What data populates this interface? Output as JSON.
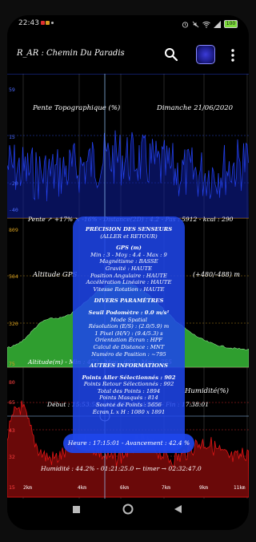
{
  "status": {
    "time": "22:43",
    "battery": "100"
  },
  "app": {
    "title": "R_AR : Chemin Du Paradis"
  },
  "panels": {
    "slope": {
      "title": "Pente Topographique (%)",
      "date": "Dimanche  21/06/2020",
      "y_top": "59",
      "y_mid": "15",
      "y_low": "-20",
      "y_bottom": "-40",
      "summary": "Pente  ↗ +17%  ↘ -16%  -  Distance(2D) : 4.2  -  Pas : 5912  -  kcal : 290"
    },
    "altitude": {
      "title_left": "Altitude GPS",
      "title_right": "(+480/-488) m",
      "y_top": "809",
      "y_mid": "564",
      "y_low": "320",
      "y_bottom": "75",
      "summary": "Altitude(m)  -  Min : 472  -  Moy : 622  -  Max : 755"
    },
    "humidity": {
      "title": "Humidité(%)",
      "y_top": "80",
      "y_m1": "65",
      "y_m2": "43",
      "y_m3": "32",
      "y_bottom": "15",
      "times": "Début : 15:53:58 - ALLER : 17:15:23 - Fin : 17:38:01",
      "summary": "Humidité : 44.2%  -  01:21:25.0 ← timer →  02:32:47.0"
    }
  },
  "overlay": {
    "lines": [
      {
        "text": "PRÉCISION DES SENSEURS",
        "h": true
      },
      {
        "text": "(ALLER et RETOUR)",
        "h": false
      },
      {
        "text": "GPS (m)",
        "h": true
      },
      {
        "text": "Min : 3 - Moy : 4.4 - Max : 9",
        "h": false
      },
      {
        "text": "Magnétisme : BASSE",
        "h": false
      },
      {
        "text": "Gravité : HAUTE",
        "h": false
      },
      {
        "text": "Position Angulaire : HAUTE",
        "h": false
      },
      {
        "text": "Accélération Linéaire : HAUTE",
        "h": false
      },
      {
        "text": "Vitesse Rotation : HAUTE",
        "h": false
      },
      {
        "text": "DIVERS PARAMÈTRES",
        "h": true
      },
      {
        "text": "Seuil Podomètre : 0.0 m/s²",
        "h": true
      },
      {
        "text": "Mode Spatial",
        "h": false
      },
      {
        "text": "Résolution (E/S) : (2.0/5.9) m",
        "h": false
      },
      {
        "text": "1 Pixel (H/V) : (9.4/5.3) s",
        "h": false
      },
      {
        "text": "Orientation Écran : HPF",
        "h": false
      },
      {
        "text": "Calcul de Distance : MNT",
        "h": false
      },
      {
        "text": "Numéro de Position : ~795",
        "h": false
      },
      {
        "text": "AUTRES INFORMATIONS",
        "h": true
      },
      {
        "text": "Points Aller Sélectionnés : 902",
        "h": true
      },
      {
        "text": "Points Retour Sélectionnés : 992",
        "h": false
      },
      {
        "text": "Total des Points : 1894",
        "h": false
      },
      {
        "text": "Points Masqués : 814",
        "h": false
      },
      {
        "text": "Source de Points : 5656",
        "h": false
      },
      {
        "text": "Écran L x H : 1080 x 1891",
        "h": false
      }
    ]
  },
  "pill": {
    "text": "Heure : 17:15:01  -  Avancement : 42.4 %"
  },
  "xaxis": {
    "ticks": [
      "2km",
      "4km",
      "6km",
      "7km",
      "9km",
      "11km"
    ]
  },
  "colors": {
    "slope": "#2a4bff",
    "altitude": "#2f9e2f",
    "humidity": "#e01515",
    "overlay": "#1e46eb"
  }
}
